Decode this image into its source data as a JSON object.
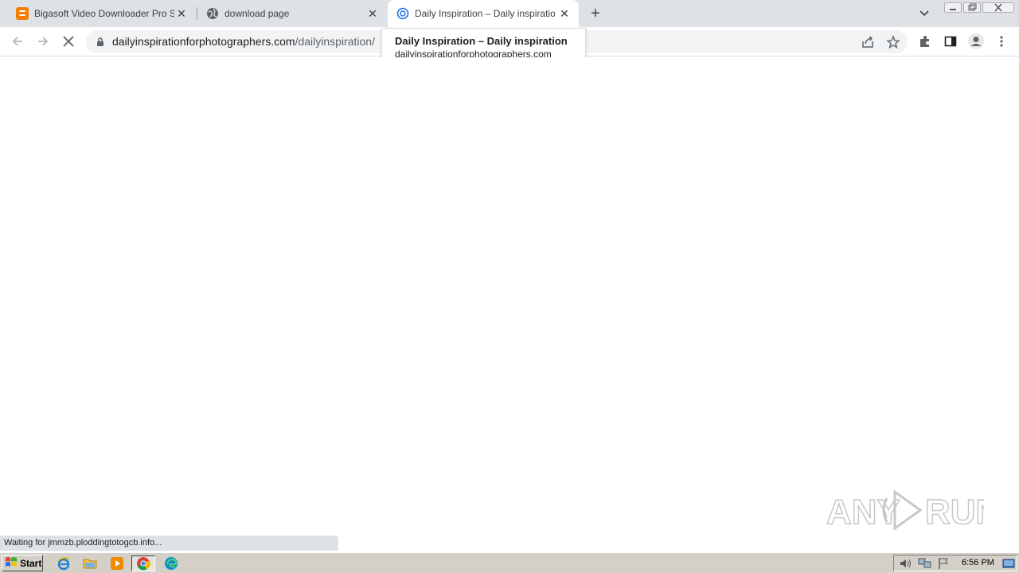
{
  "browser": {
    "tabs": [
      {
        "title": "Bigasoft Video Downloader Pro Serial",
        "icon": "blogger-icon",
        "active": false
      },
      {
        "title": "download page",
        "icon": "globe-icon",
        "active": false
      },
      {
        "title": "Daily Inspiration – Daily inspiration",
        "icon": "site-favicon",
        "active": true
      }
    ],
    "new_tab_label": "+",
    "url": {
      "domain": "dailyinspirationforphotographers.com",
      "path": "/dailyinspiration/"
    },
    "hover_card": {
      "title": "Daily Inspiration – Daily inspiration",
      "domain": "dailyinspirationforphotographers.com"
    },
    "status_text": "Waiting for jmmzb.ploddingtotogcb.info..."
  },
  "watermark": {
    "text": "ANY RUN"
  },
  "taskbar": {
    "start_label": "Start",
    "pinned": [
      "ie-icon",
      "folder-icon",
      "media-player-icon",
      "chrome-icon",
      "edge-icon"
    ],
    "clock": "6:56 PM"
  },
  "colors": {
    "tabstrip_bg": "#dee1e6",
    "omnibox_bg": "#f1f3f4",
    "taskbar_bg": "#d4d0c8",
    "blogger_orange": "#f57d00"
  }
}
